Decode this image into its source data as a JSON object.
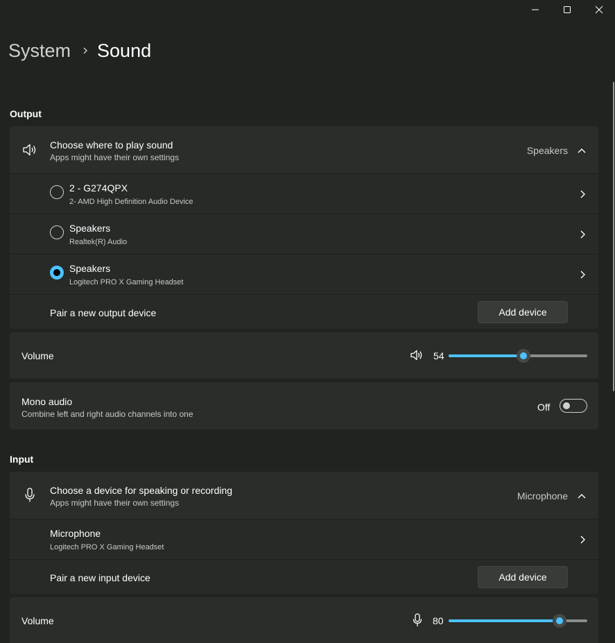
{
  "window_controls": {
    "minimize": "minimize",
    "maximize": "maximize",
    "close": "close"
  },
  "breadcrumb": {
    "parent": "System",
    "current": "Sound"
  },
  "output": {
    "header": "Output",
    "choose": {
      "title": "Choose where to play sound",
      "subtitle": "Apps might have their own settings",
      "selected": "Speakers"
    },
    "devices": [
      {
        "name": "2 - G274QPX",
        "detail": "2- AMD High Definition Audio Device",
        "selected": false
      },
      {
        "name": "Speakers",
        "detail": "Realtek(R) Audio",
        "selected": false
      },
      {
        "name": "Speakers",
        "detail": "Logitech PRO X Gaming Headset",
        "selected": true
      }
    ],
    "pair": {
      "label": "Pair a new output device",
      "button": "Add device"
    },
    "volume": {
      "label": "Volume",
      "value": "54",
      "level": 0.54
    },
    "mono": {
      "title": "Mono audio",
      "subtitle": "Combine left and right audio channels into one",
      "state": "Off"
    }
  },
  "input": {
    "header": "Input",
    "choose": {
      "title": "Choose a device for speaking or recording",
      "subtitle": "Apps might have their own settings",
      "selected": "Microphone"
    },
    "devices": [
      {
        "name": "Microphone",
        "detail": "Logitech PRO X Gaming Headset"
      }
    ],
    "pair": {
      "label": "Pair a new input device",
      "button": "Add device"
    },
    "volume": {
      "label": "Volume",
      "value": "80",
      "level": 0.8
    }
  },
  "colors": {
    "accent": "#4cc2ff",
    "background": "#202420",
    "card": "#2a2d2a"
  }
}
